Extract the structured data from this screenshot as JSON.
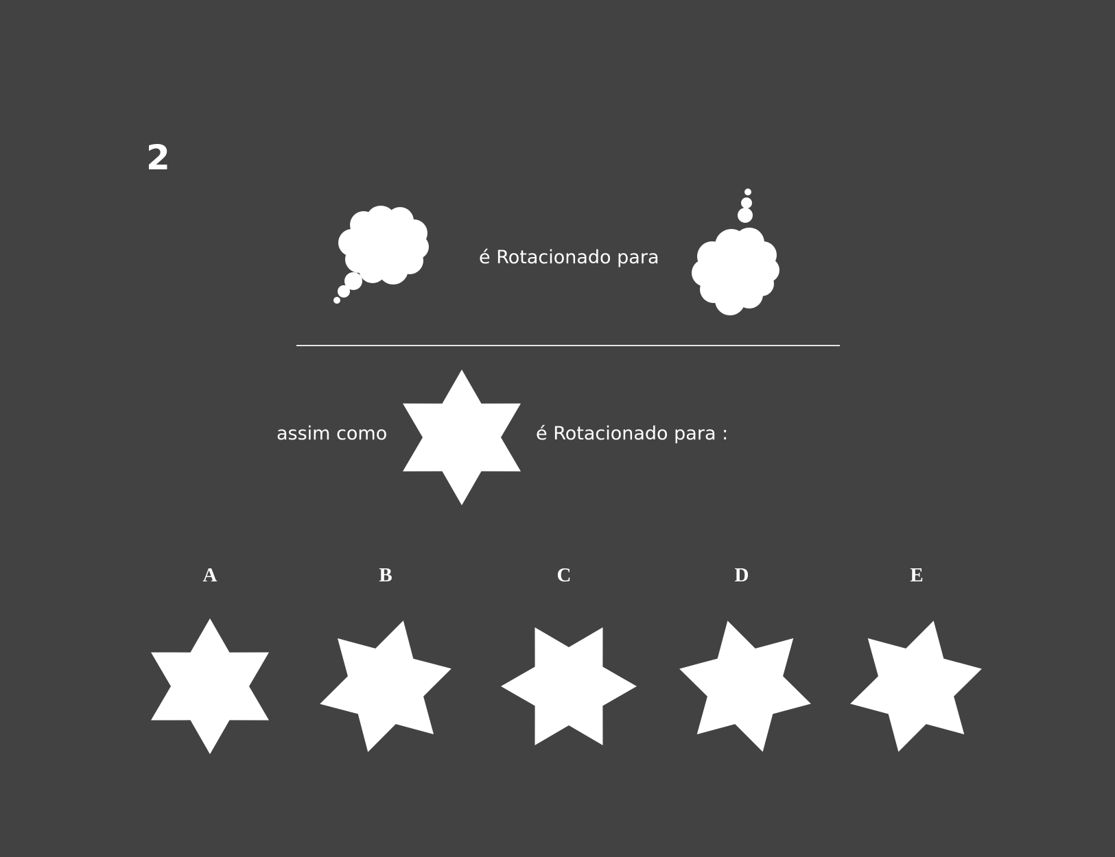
{
  "question": {
    "number": "2"
  },
  "statement": {
    "first_relation": "é Rotacionado para",
    "analogy_prefix": "assim como",
    "second_relation": "é Rotacionado para :"
  },
  "colors": {
    "background": "#424242",
    "foreground": "#ffffff"
  },
  "icons": {
    "example_original": "thought-bubble-icon",
    "example_rotated": "thought-bubble-rotated-icon",
    "prompt_shape": "six-point-star-icon"
  },
  "options": [
    {
      "label": "A",
      "rotation_degrees": 0
    },
    {
      "label": "B",
      "rotation_degrees": -45
    },
    {
      "label": "C",
      "rotation_degrees": 90
    },
    {
      "label": "D",
      "rotation_degrees": -15
    },
    {
      "label": "E",
      "rotation_degrees": 15
    }
  ]
}
